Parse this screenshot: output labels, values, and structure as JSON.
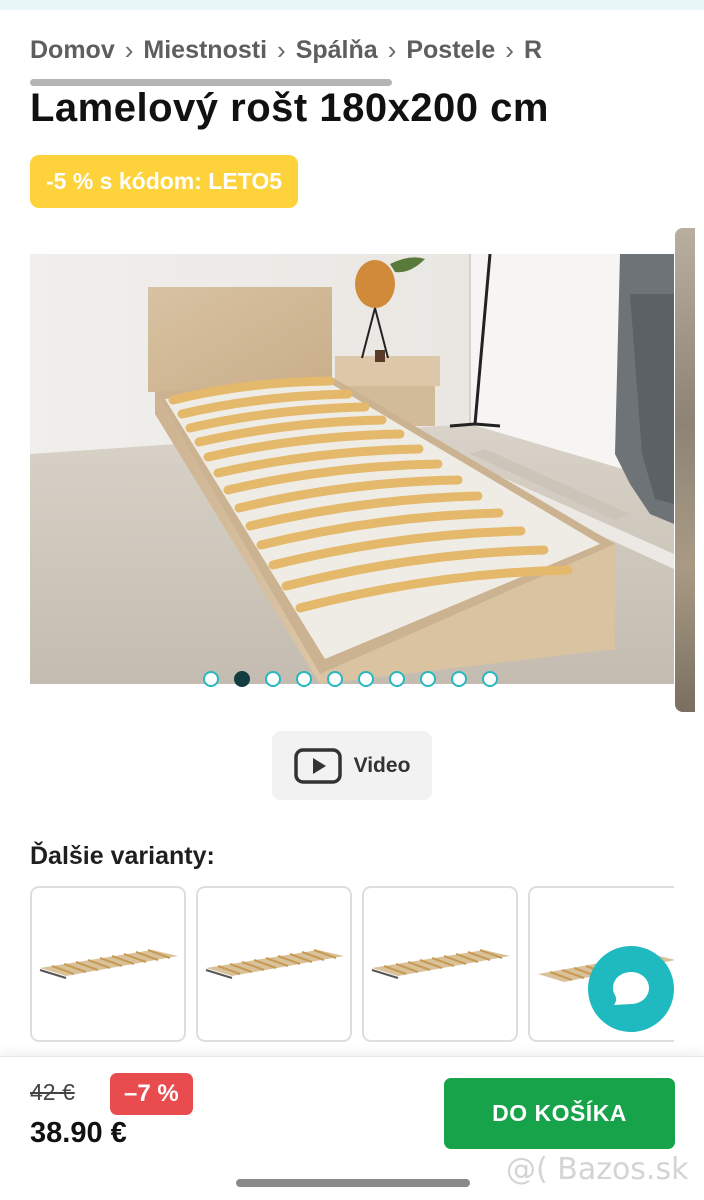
{
  "breadcrumb": {
    "items": [
      "Domov",
      "Miestnosti",
      "Spálňa",
      "Postele",
      "R"
    ],
    "separator": "›"
  },
  "product": {
    "title": "Lamelový rošt 180x200 cm",
    "promo": "-5 % s kódom: LETO5"
  },
  "gallery": {
    "image_count": 10,
    "active_index": 1
  },
  "video": {
    "label": "Video",
    "icon": "play-icon"
  },
  "variants": {
    "title": "Ďalšie varianty:",
    "count": 4
  },
  "chat": {
    "icon": "chat-bubble-icon"
  },
  "pricing": {
    "old_price": "42 €",
    "discount": "–7 %",
    "price": "38.90 €"
  },
  "cart": {
    "label": "DO KOŠÍKA"
  },
  "watermark": "@( Bazos.sk",
  "colors": {
    "promo": "#fdd23b",
    "accent": "#1fb9c0",
    "discount": "#e84c4f",
    "cart": "#16a34a"
  }
}
